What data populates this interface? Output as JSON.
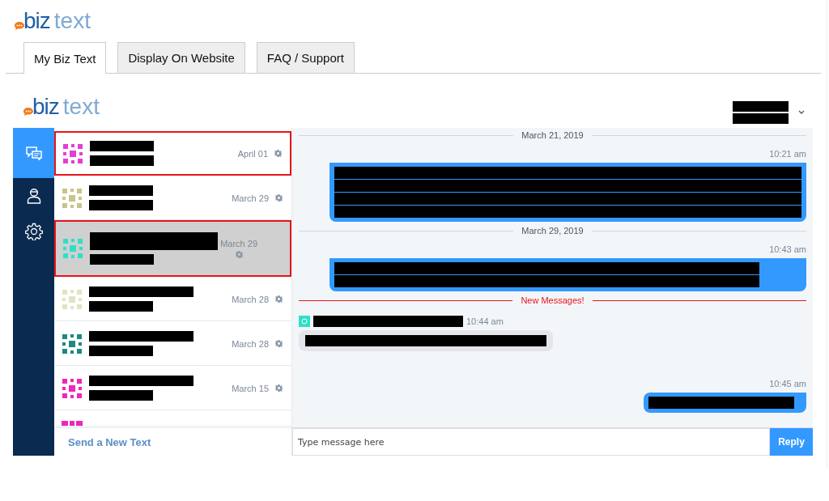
{
  "logo": {
    "word_1": "biz",
    "word_2": "text"
  },
  "tabs": [
    {
      "label": "My Biz Text",
      "selected": true
    },
    {
      "label": "Display On Website",
      "selected": false
    },
    {
      "label": "FAQ / Support",
      "selected": false
    }
  ],
  "panel_logo": {
    "word_1": "biz",
    "word_2": "text"
  },
  "nav": [
    {
      "kind": "chat",
      "selected": true
    },
    {
      "kind": "person",
      "selected": false
    },
    {
      "kind": "settings",
      "selected": false
    }
  ],
  "conversations": [
    {
      "date": "April 01",
      "color": "#e23fd6",
      "selected": false,
      "flagged": true
    },
    {
      "date": "March 29",
      "color": "#c8c48a",
      "selected": false,
      "flagged": false
    },
    {
      "date": "March 29",
      "color": "#2ee0c8",
      "selected": true,
      "flagged": true
    },
    {
      "date": "March 28",
      "color": "#dfe5c2",
      "selected": false,
      "flagged": false
    },
    {
      "date": "March 28",
      "color": "#1e8a80",
      "selected": false,
      "flagged": false
    },
    {
      "date": "March 15",
      "color": "#f026b8",
      "selected": false,
      "flagged": false
    }
  ],
  "send_new_text": "Send a New Text",
  "messages": [
    {
      "kind": "date",
      "text": "March 21, 2019"
    },
    {
      "kind": "outgoing",
      "time": "10:21 am"
    },
    {
      "kind": "date",
      "text": "March 29, 2019"
    },
    {
      "kind": "outgoing",
      "time": "10:43 am"
    },
    {
      "kind": "new",
      "text": "New Messages!"
    },
    {
      "kind": "incoming",
      "time": "10:44 am"
    },
    {
      "kind": "outgoing",
      "time": "10:45 am"
    }
  ],
  "composer": {
    "placeholder": "Type message here",
    "button": "Reply"
  }
}
